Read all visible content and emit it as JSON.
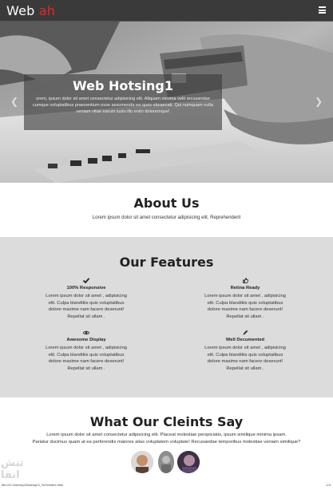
{
  "navbar": {
    "brand_main": "Web ",
    "brand_accent": "ah",
    "menu_icon": "hamburger-menu-icon",
    "accent_color": "#e8252a"
  },
  "hero": {
    "title": "Web Hotsing1",
    "text": "orem, ipsum dolor sit amet consectetur adipisicing elit. Aliquam minima velit recusandae cumque voluptatibus praesentium esse assumenda ea quos obcaecati. Qui numquam nulla veniam vitae earum iusto illo enim doloremque!",
    "prev_icon": "chevron-left-icon",
    "next_icon": "chevron-right-icon"
  },
  "about": {
    "title": "About Us",
    "text": "Lorem ipsum dolor sit amet consectetur adipisicing elit. Reprehenderit"
  },
  "features": {
    "title": "Our Features",
    "items": [
      {
        "icon": "check-icon",
        "title": "100% Responsive",
        "text": "Lorem ipsum dolor sit amet , adipisicing elit. Culpa blanditiis quis voluptatibus dolore maxime nam facere deserunt! Repellat sit ullam ."
      },
      {
        "icon": "thumbs-up-icon",
        "title": "Retina Ready",
        "text": "Lorem ipsum dolor sit amet , adipisicing elit. Culpa blanditiis quis voluptatibus dolore maxime nam facere deserunt! Repellat sit ullam ."
      },
      {
        "icon": "eye-icon",
        "title": "Awesome Display",
        "text": "Lorem ipsum dolor sit amet , adipisicing elit. Culpa blanditiis quis voluptatibus dolore maxime nam facere deserunt! Repellat sit ullam ."
      },
      {
        "icon": "pencil-icon",
        "title": "Well Decumented",
        "text": "Lorem ipsum dolor sit amet , adipisicing elit. Culpa blanditiis quis voluptatibus dolore maxime nam facere deserunt! Repellat sit ullam ."
      }
    ]
  },
  "clients": {
    "title": "What Our Cleints Say",
    "text1": "Lorem ipsum dolor sit amet consectetur adipisicing elit. Placeat molestiae perspiciatis, ipsum similique minima ipsam.",
    "text2": "Pariatur ducimus quam at ea perferendis maiores alias voluptatem voluptate! Recusandae temporibus molestiae veniam similique?"
  },
  "status": {
    "path": "file:///C:/Users/p/Desktop/3_%20/index.html",
    "page": "1/4"
  }
}
